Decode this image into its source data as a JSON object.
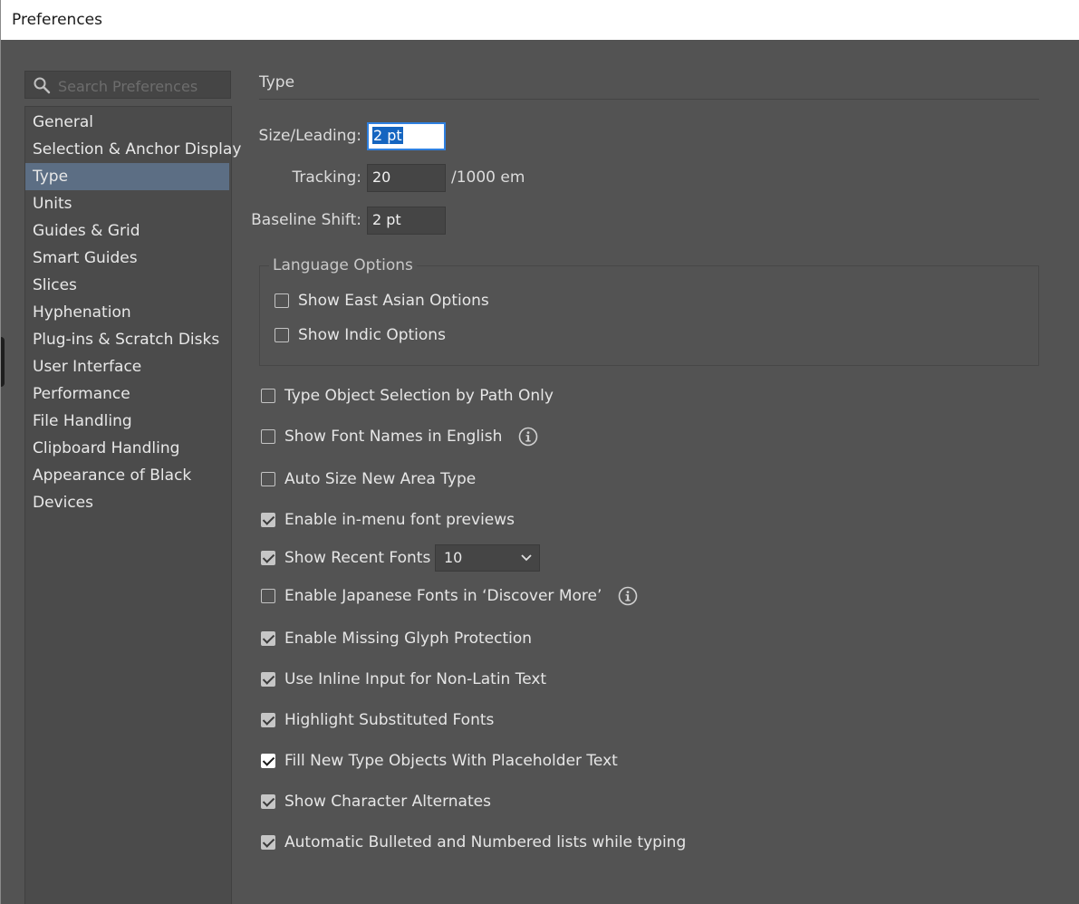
{
  "window": {
    "title": "Preferences"
  },
  "search": {
    "placeholder": "Search Preferences",
    "value": ""
  },
  "sidebar": {
    "items": [
      {
        "label": "General"
      },
      {
        "label": "Selection & Anchor Display"
      },
      {
        "label": "Type",
        "active": true
      },
      {
        "label": "Units"
      },
      {
        "label": "Guides & Grid"
      },
      {
        "label": "Smart Guides"
      },
      {
        "label": "Slices"
      },
      {
        "label": "Hyphenation"
      },
      {
        "label": "Plug-ins & Scratch Disks"
      },
      {
        "label": "User Interface"
      },
      {
        "label": "Performance"
      },
      {
        "label": "File Handling"
      },
      {
        "label": "Clipboard Handling"
      },
      {
        "label": "Appearance of Black"
      },
      {
        "label": "Devices"
      }
    ]
  },
  "main": {
    "title": "Type",
    "size_leading": {
      "label": "Size/Leading:",
      "value": "2 pt"
    },
    "tracking": {
      "label": "Tracking:",
      "value": "20",
      "unit": "/1000 em"
    },
    "baseline_shift": {
      "label": "Baseline Shift:",
      "value": "2 pt"
    },
    "language_options": {
      "title": "Language Options",
      "items": [
        {
          "label": "Show East Asian Options",
          "checked": false
        },
        {
          "label": "Show Indic Options",
          "checked": false
        }
      ]
    },
    "options": [
      {
        "label": "Type Object Selection by Path Only",
        "checked": false
      },
      {
        "label": "Show Font Names in English",
        "checked": false,
        "info": true
      },
      {
        "label": "Auto Size New Area Type",
        "checked": false
      },
      {
        "label": "Enable in-menu font previews",
        "checked": true
      },
      {
        "label": "Show Recent Fonts",
        "checked": true
      },
      {
        "label": "Enable Japanese Fonts in ‘Discover More’",
        "checked": false,
        "info": true
      },
      {
        "label": "Enable Missing Glyph Protection",
        "checked": true
      },
      {
        "label": "Use Inline Input for Non-Latin Text",
        "checked": true
      },
      {
        "label": "Highlight Substituted Fonts",
        "checked": true
      },
      {
        "label": "Fill New Type Objects With Placeholder Text",
        "checked": true
      },
      {
        "label": "Show Character Alternates",
        "checked": true
      },
      {
        "label": "Automatic Bulleted and Numbered lists while typing",
        "checked": true
      }
    ],
    "recent_fonts_count": {
      "value": "10"
    }
  },
  "icons": {
    "search": "search-icon",
    "info": "info-icon",
    "chevron": "chevron-down-icon"
  },
  "colors": {
    "background": "#535353",
    "sidebar": "#4b4b4b",
    "selected_item": "#5c6e84",
    "focus_border": "#2f80e0"
  }
}
